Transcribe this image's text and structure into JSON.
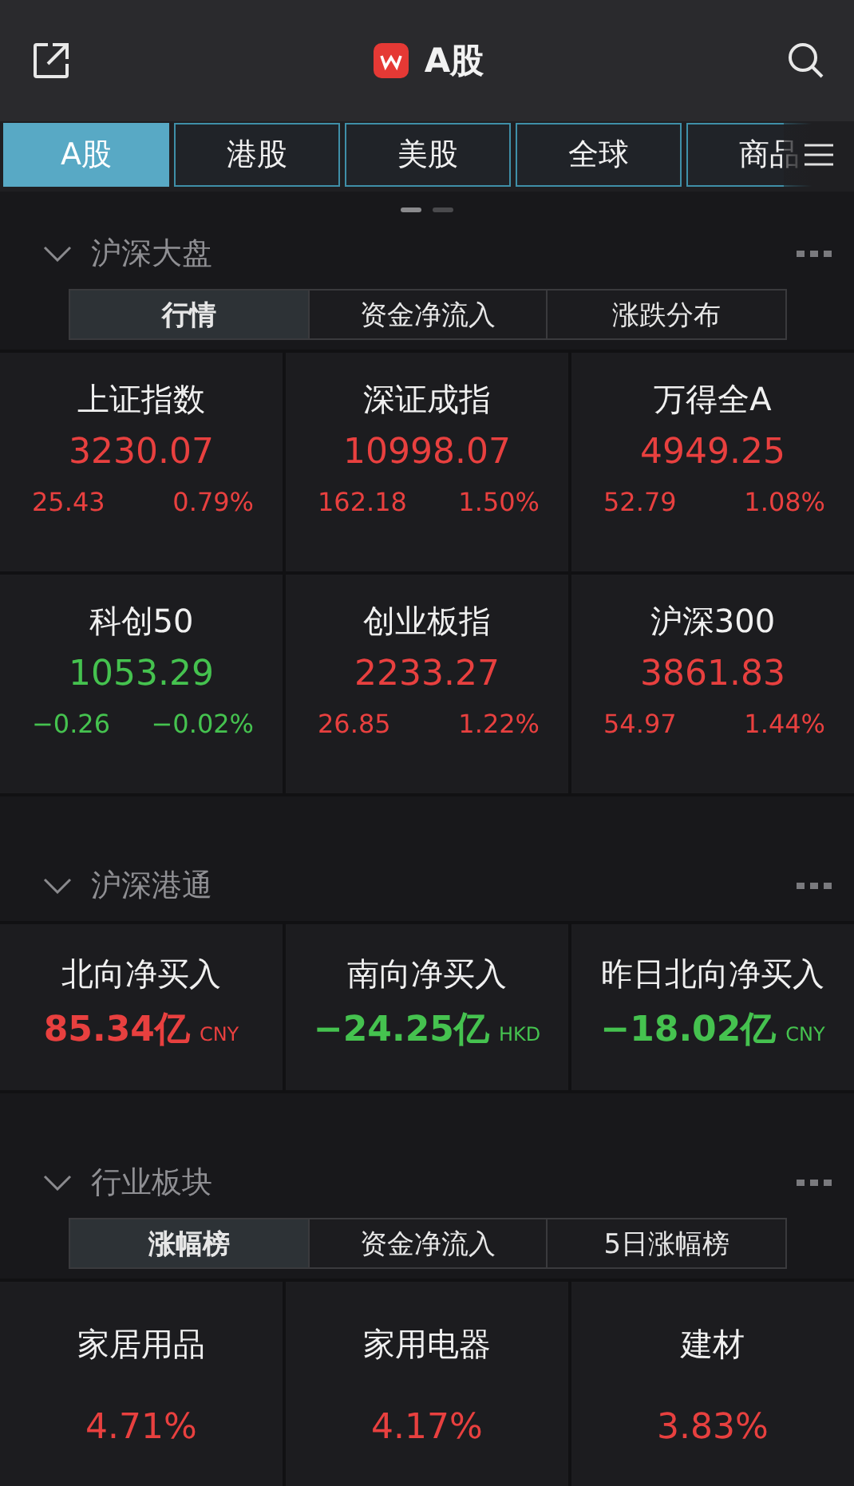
{
  "header": {
    "title": "A股"
  },
  "tabs": [
    {
      "label": "A股",
      "selected": true
    },
    {
      "label": "港股",
      "selected": false
    },
    {
      "label": "美股",
      "selected": false
    },
    {
      "label": "全球",
      "selected": false
    },
    {
      "label": "商品",
      "selected": false
    }
  ],
  "pager": [
    {
      "selected": true
    },
    {
      "selected": false
    }
  ],
  "sections": [
    {
      "title": "沪深大盘",
      "expanded": true,
      "kind": "index",
      "segments": [
        {
          "label": "行情",
          "selected": true
        },
        {
          "label": "资金净流入",
          "selected": false
        },
        {
          "label": "涨跌分布",
          "selected": false
        }
      ],
      "items": [
        {
          "name": "上证指数",
          "value": "3230.07",
          "change": "25.43",
          "percent": "0.79%",
          "rising": true
        },
        {
          "name": "深证成指",
          "value": "10998.07",
          "change": "162.18",
          "percent": "1.50%",
          "rising": true
        },
        {
          "name": "万得全A",
          "value": "4949.25",
          "change": "52.79",
          "percent": "1.08%",
          "rising": true
        },
        {
          "name": "科创50",
          "value": "1053.29",
          "change": "−0.26",
          "percent": "−0.02%",
          "rising": false
        },
        {
          "name": "创业板指",
          "value": "2233.27",
          "change": "26.85",
          "percent": "1.22%",
          "rising": true
        },
        {
          "name": "沪深300",
          "value": "3861.83",
          "change": "54.97",
          "percent": "1.44%",
          "rising": true
        }
      ]
    },
    {
      "title": "沪深港通",
      "expanded": true,
      "kind": "flow",
      "items": [
        {
          "name": "北向净买入",
          "value": "85.34亿",
          "unit": "CNY",
          "rising": true
        },
        {
          "name": "南向净买入",
          "value": "−24.25亿",
          "unit": "HKD",
          "rising": false
        },
        {
          "name": "昨日北向净买入",
          "value": "−18.02亿",
          "unit": "CNY",
          "rising": false
        }
      ]
    },
    {
      "title": "行业板块",
      "expanded": true,
      "kind": "sector",
      "segments": [
        {
          "label": "涨幅榜",
          "selected": true
        },
        {
          "label": "资金净流入",
          "selected": false
        },
        {
          "label": "5日涨幅榜",
          "selected": false
        }
      ],
      "items": [
        {
          "name": "家居用品",
          "percent": "4.71%",
          "rising": true
        },
        {
          "name": "家用电器",
          "percent": "4.17%",
          "rising": true
        },
        {
          "name": "建材",
          "percent": "3.83%",
          "rising": true
        }
      ]
    }
  ]
}
